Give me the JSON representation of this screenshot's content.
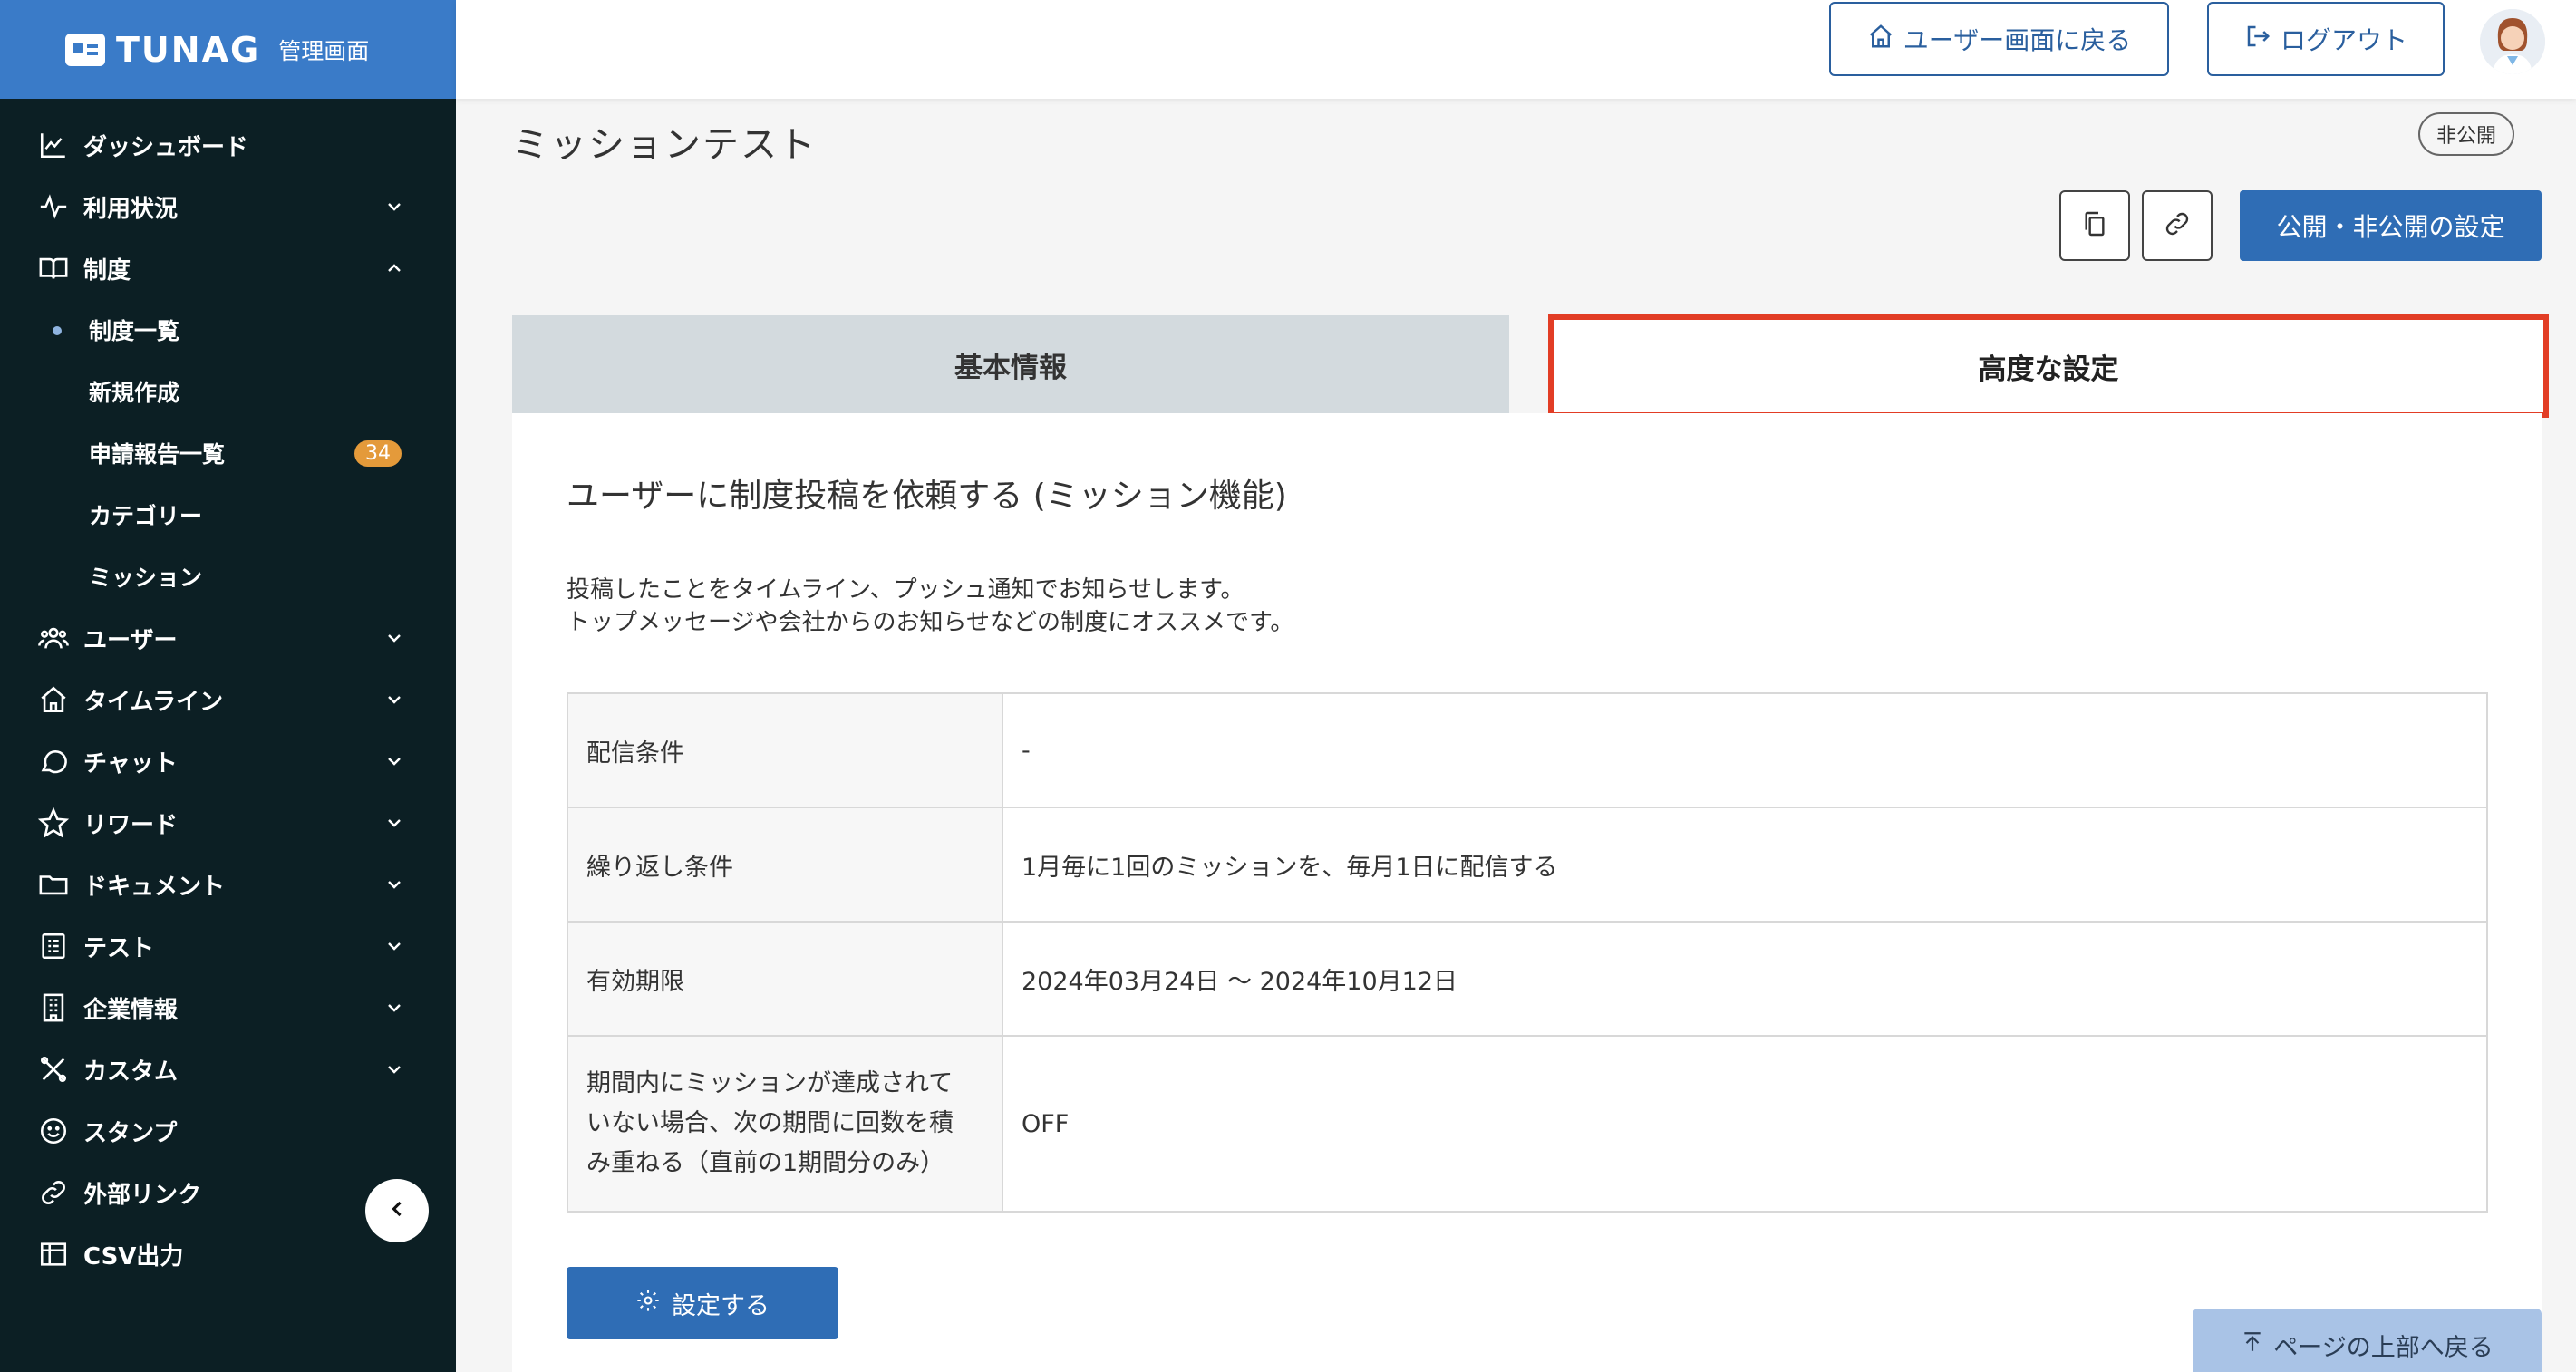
{
  "brand": {
    "name": "TUNAG",
    "subtitle": "管理画面",
    "color": "#3a7bc8"
  },
  "header": {
    "user_screen_button": "ユーザー画面に戻る",
    "logout_button": "ログアウト"
  },
  "sidebar": {
    "items": [
      {
        "label": "ダッシュボード",
        "icon": "chart-line-icon"
      },
      {
        "label": "利用状況",
        "icon": "pulse-icon",
        "expandable": true
      },
      {
        "label": "制度",
        "icon": "book-icon",
        "expanded": true
      },
      {
        "label": "ユーザー",
        "icon": "users-icon",
        "expandable": true
      },
      {
        "label": "タイムライン",
        "icon": "home-icon",
        "expandable": true
      },
      {
        "label": "チャット",
        "icon": "chat-icon",
        "expandable": true
      },
      {
        "label": "リワード",
        "icon": "star-icon",
        "expandable": true
      },
      {
        "label": "ドキュメント",
        "icon": "folder-icon",
        "expandable": true
      },
      {
        "label": "テスト",
        "icon": "checklist-icon",
        "expandable": true
      },
      {
        "label": "企業情報",
        "icon": "building-icon",
        "expandable": true
      },
      {
        "label": "カスタム",
        "icon": "tools-icon",
        "expandable": true
      },
      {
        "label": "スタンプ",
        "icon": "smile-icon"
      },
      {
        "label": "外部リンク",
        "icon": "link-icon"
      },
      {
        "label": "CSV出力",
        "icon": "table-icon"
      }
    ],
    "sub_items": [
      {
        "label": "制度一覧",
        "active": true
      },
      {
        "label": "新規作成"
      },
      {
        "label": "申請報告一覧",
        "badge": "34"
      },
      {
        "label": "カテゴリー"
      },
      {
        "label": "ミッション"
      }
    ]
  },
  "page": {
    "title": "ミッションテスト",
    "status": "非公開",
    "publish_button": "公開・非公開の設定"
  },
  "tabs": [
    {
      "label": "基本情報"
    },
    {
      "label": "高度な設定",
      "selected": true
    }
  ],
  "mission": {
    "title": "ユーザーに制度投稿を依頼する (ミッション機能)",
    "description": [
      "投稿したことをタイムライン、プッシュ通知でお知らせします。",
      "トップメッセージや会社からのお知らせなどの制度にオススメです。"
    ],
    "rows": [
      {
        "key": "配信条件",
        "value": "-"
      },
      {
        "key": "繰り返し条件",
        "value": "1月毎に1回のミッションを、毎月1日に配信する"
      },
      {
        "key": "有効期限",
        "value": "2024年03月24日 〜 2024年10月12日"
      },
      {
        "key_lines": [
          "期間内にミッションが達成されて",
          "いない場合、次の期間に回数を積",
          "み重ねる（直前の1期間分のみ）"
        ],
        "value": "OFF"
      }
    ],
    "settings_button": "設定する"
  },
  "back_to_top": "ページの上部へ戻る",
  "colors": {
    "sidebar_bg": "#0c1f24",
    "primary": "#2f6db5",
    "highlight": "#e23d25",
    "badge": "#e49a3a"
  }
}
